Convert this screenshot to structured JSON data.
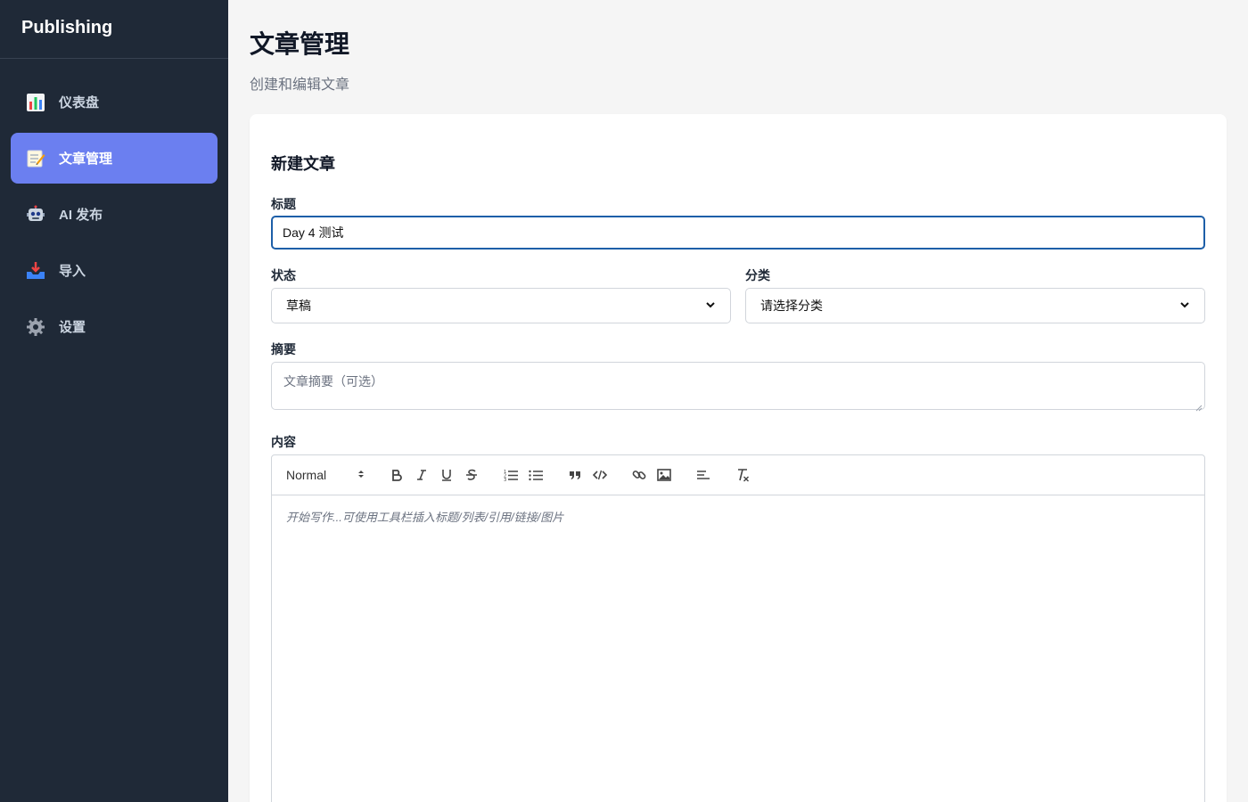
{
  "sidebar": {
    "brand": "Publishing",
    "items": [
      {
        "label": "仪表盘",
        "icon": "bar-chart-icon",
        "active": false
      },
      {
        "label": "文章管理",
        "icon": "memo-icon",
        "active": true
      },
      {
        "label": "AI 发布",
        "icon": "robot-icon",
        "active": false
      },
      {
        "label": "导入",
        "icon": "inbox-tray-icon",
        "active": false
      },
      {
        "label": "设置",
        "icon": "gear-icon",
        "active": false
      }
    ]
  },
  "header": {
    "title": "文章管理",
    "subtitle": "创建和编辑文章"
  },
  "form": {
    "card_title": "新建文章",
    "title_label": "标题",
    "title_value": "Day 4 测试",
    "status_label": "状态",
    "status_value": "草稿",
    "category_label": "分类",
    "category_value": "请选择分类",
    "summary_label": "摘要",
    "summary_placeholder": "文章摘要（可选）",
    "content_label": "内容"
  },
  "editor": {
    "heading_value": "Normal",
    "placeholder": "开始写作...可使用工具栏插入标题/列表/引用/链接/图片"
  },
  "colors": {
    "sidebar_bg": "#1f2937",
    "active_item": "#6b7ff0",
    "focus_border": "#1d5fa8"
  }
}
